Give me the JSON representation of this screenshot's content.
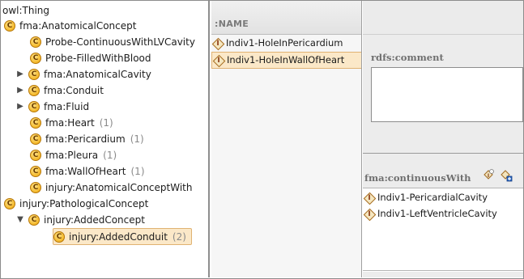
{
  "tree": {
    "root": "owl:Thing",
    "items": [
      {
        "label": "fma:AnatomicalConcept",
        "count": ""
      },
      {
        "label": "Probe-ContinuousWithLVCavity",
        "count": ""
      },
      {
        "label": "Probe-FilledWithBlood",
        "count": ""
      },
      {
        "label": "fma:AnatomicalCavity",
        "count": ""
      },
      {
        "label": "fma:Conduit",
        "count": ""
      },
      {
        "label": "fma:Fluid",
        "count": ""
      },
      {
        "label": "fma:Heart",
        "count": "(1)"
      },
      {
        "label": "fma:Pericardium",
        "count": "(1)"
      },
      {
        "label": "fma:Pleura",
        "count": "(1)"
      },
      {
        "label": "fma:WallOfHeart",
        "count": "(1)"
      },
      {
        "label": "injury:AnatomicalConceptWith",
        "count": ""
      },
      {
        "label": "injury:PathologicalConcept",
        "count": ""
      },
      {
        "label": "injury:AddedConcept",
        "count": ""
      },
      {
        "label": "injury:AddedConduit",
        "count": "(2)"
      }
    ],
    "class_icon_letter": "C",
    "expand_collapsed_glyph": "▶",
    "expand_open_glyph": "▼"
  },
  "instances": {
    "header": ":NAME",
    "items": [
      {
        "label": "Indiv1-HoleInPericardium"
      },
      {
        "label": "Indiv1-HoleInWallOfHeart"
      }
    ]
  },
  "form": {
    "comment_label": "rdfs:comment",
    "continuous_label": "fma:continuousWith",
    "continuous_values": [
      {
        "label": "Indiv1-PericardialCavity"
      },
      {
        "label": "Indiv1-LeftVentricleCavity"
      }
    ]
  },
  "colors": {
    "selection_bg": "#fbe8c8",
    "class_icon": "#f4b82a",
    "instance_icon": "#a56a1d"
  }
}
